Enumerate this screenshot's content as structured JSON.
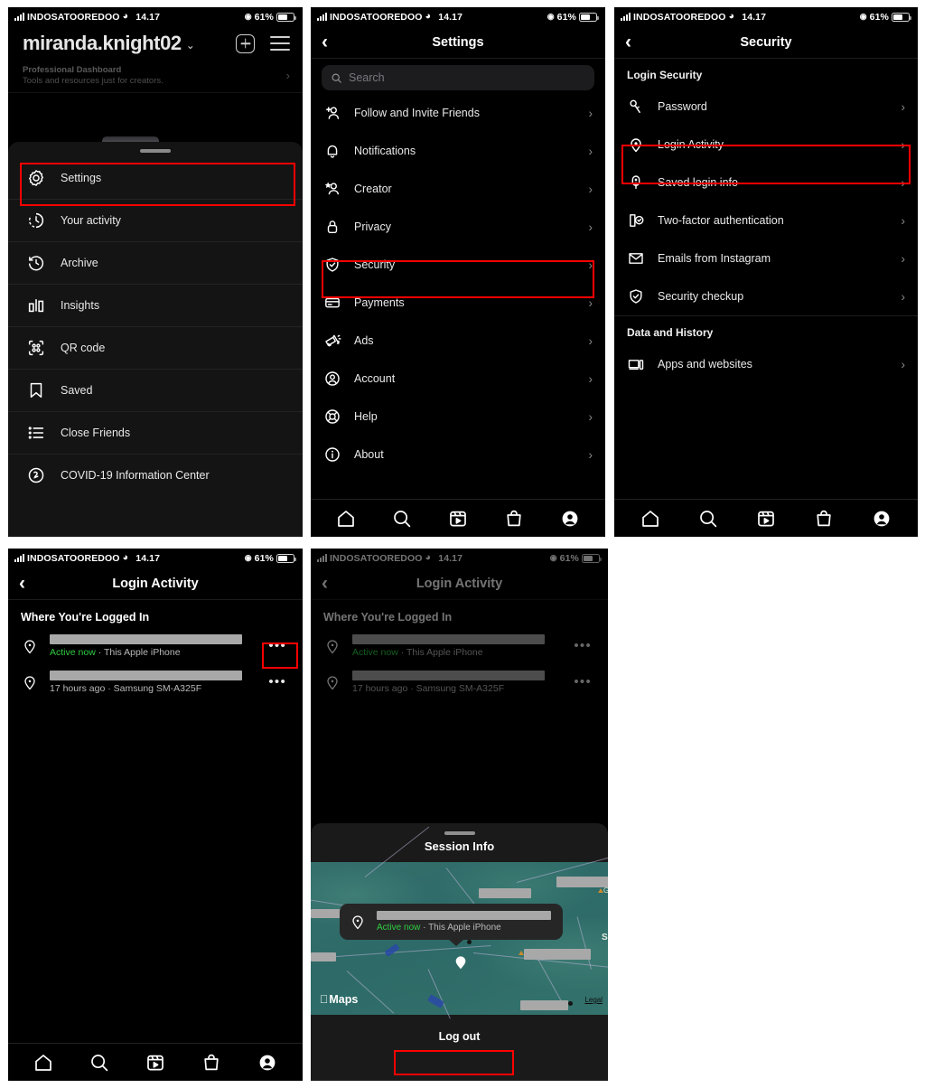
{
  "status_bar": {
    "carrier": "INDOSATOOREDOO",
    "time": "14.17",
    "battery_pct": "61%",
    "wifi_icon": "wifi-icon",
    "signal_icon": "signal-bars-icon",
    "location_icon": "location-arrow-icon",
    "battery_icon": "battery-icon"
  },
  "panel1": {
    "profile": {
      "username": "miranda.knight02",
      "chevron": "⌄",
      "add_icon": "plus-square-icon",
      "menu_icon": "hamburger-menu-icon"
    },
    "dashboard": {
      "title": "Professional Dashboard",
      "subtitle": "Tools and resources just for creators.",
      "chevron": "›"
    },
    "menu": [
      {
        "label": "Settings",
        "icon": "gear-icon",
        "highlighted": true
      },
      {
        "label": "Your activity",
        "icon": "clock-activity-icon",
        "highlighted": false
      },
      {
        "label": "Archive",
        "icon": "archive-clock-icon",
        "highlighted": false
      },
      {
        "label": "Insights",
        "icon": "bar-chart-icon",
        "highlighted": false
      },
      {
        "label": "QR code",
        "icon": "qr-code-icon",
        "highlighted": false
      },
      {
        "label": "Saved",
        "icon": "bookmark-icon",
        "highlighted": false
      },
      {
        "label": "Close Friends",
        "icon": "close-friends-list-icon",
        "highlighted": false
      },
      {
        "label": "COVID-19 Information Center",
        "icon": "covid-info-icon",
        "highlighted": false
      }
    ]
  },
  "panel2": {
    "title": "Settings",
    "back_icon": "chevron-left-icon",
    "search": {
      "placeholder": "Search",
      "value": "",
      "icon": "search-icon"
    },
    "items": [
      {
        "label": "Follow and Invite Friends",
        "icon": "add-person-icon",
        "highlighted": false
      },
      {
        "label": "Notifications",
        "icon": "bell-icon",
        "highlighted": false
      },
      {
        "label": "Creator",
        "icon": "star-person-icon",
        "highlighted": false
      },
      {
        "label": "Privacy",
        "icon": "lock-icon",
        "highlighted": false
      },
      {
        "label": "Security",
        "icon": "shield-check-icon",
        "highlighted": true
      },
      {
        "label": "Payments",
        "icon": "credit-card-icon",
        "highlighted": false
      },
      {
        "label": "Ads",
        "icon": "megaphone-icon",
        "highlighted": false
      },
      {
        "label": "Account",
        "icon": "account-circle-icon",
        "highlighted": false
      },
      {
        "label": "Help",
        "icon": "lifebuoy-icon",
        "highlighted": false
      },
      {
        "label": "About",
        "icon": "info-circle-icon",
        "highlighted": false
      }
    ],
    "chevron": "›"
  },
  "panel3": {
    "title": "Security",
    "back_icon": "chevron-left-icon",
    "sections": [
      {
        "heading": "Login Security",
        "items": [
          {
            "label": "Password",
            "icon": "key-icon",
            "highlighted": false
          },
          {
            "label": "Login Activity",
            "icon": "location-pin-icon",
            "highlighted": true
          },
          {
            "label": "Saved login info",
            "icon": "saved-login-icon",
            "highlighted": false
          },
          {
            "label": "Two-factor authentication",
            "icon": "two-factor-icon",
            "highlighted": false
          },
          {
            "label": "Emails from Instagram",
            "icon": "envelope-icon",
            "highlighted": false
          },
          {
            "label": "Security checkup",
            "icon": "shield-check-icon",
            "highlighted": false
          }
        ]
      },
      {
        "heading": "Data and History",
        "items": [
          {
            "label": "Apps and websites",
            "icon": "apps-devices-icon",
            "highlighted": false
          }
        ]
      }
    ],
    "chevron": "›"
  },
  "panel4": {
    "title": "Login Activity",
    "back_icon": "chevron-left-icon",
    "section_heading": "Where You're Logged In",
    "sessions": [
      {
        "location_redacted": true,
        "status": "Active now",
        "separator": " · ",
        "device": "This Apple iPhone",
        "more_icon": "more-options-icon",
        "more_highlighted": true
      },
      {
        "location_redacted": true,
        "status": "17 hours ago",
        "separator": " · ",
        "device": "Samsung SM-A325F",
        "more_icon": "more-options-icon",
        "more_highlighted": false
      }
    ]
  },
  "panel5": {
    "title": "Login Activity",
    "back_icon": "chevron-left-icon",
    "section_heading": "Where You're Logged In",
    "sessions": [
      {
        "status": "Active now",
        "separator": " · ",
        "device": "This Apple iPhone",
        "more_icon": "more-options-icon"
      },
      {
        "status": "17 hours ago",
        "separator": " · ",
        "device": "Samsung SM-A325F",
        "more_icon": "more-options-icon"
      }
    ],
    "sheet": {
      "title": "Session Info",
      "grabber": "drag-handle",
      "map": {
        "attribution": "Maps",
        "apple_logo": "apple-logo-icon",
        "legal_link": "Legal",
        "pin_icon": "map-pin-icon"
      },
      "callout": {
        "status": "Active now",
        "separator": " · ",
        "device": "This Apple iPhone",
        "pin_icon": "location-pin-icon"
      },
      "logout_label": "Log out",
      "logout_highlighted": true
    }
  },
  "tabbar": {
    "items": [
      {
        "icon": "home-icon",
        "name": "tab-home"
      },
      {
        "icon": "search-icon",
        "name": "tab-search"
      },
      {
        "icon": "reels-icon",
        "name": "tab-reels"
      },
      {
        "icon": "shop-icon",
        "name": "tab-shop"
      },
      {
        "icon": "profile-icon",
        "name": "tab-profile"
      }
    ]
  },
  "colors": {
    "accent_red": "#ff0000",
    "active_green": "#2ecc40",
    "background": "#000000",
    "sheet": "#141414"
  }
}
